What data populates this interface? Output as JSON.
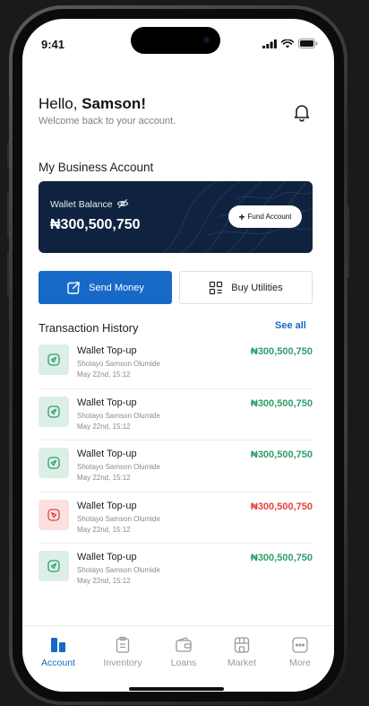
{
  "status_bar": {
    "time": "9:41"
  },
  "header": {
    "greeting_prefix": "Hello, ",
    "user_name": "Samson!",
    "subtitle": "Welcome back to your account."
  },
  "business_account": {
    "section_title": "My Business Account",
    "wallet_label": "Wallet Balance",
    "balance": "₦300,500,750",
    "fund_button_label": "Fund Account",
    "card_color": "#0f2340"
  },
  "actions": {
    "send_money_label": "Send Money",
    "buy_utilities_label": "Buy Utilities",
    "accent_color": "#1769c7"
  },
  "transactions": {
    "title": "Transaction History",
    "see_all_label": "See all",
    "items": [
      {
        "name": "Wallet Top-up",
        "person": "Shotayo Samson Olumide",
        "date": "May 22nd, 15:12",
        "amount": "₦300,500,750",
        "direction": "in"
      },
      {
        "name": "Wallet Top-up",
        "person": "Shotayo Samson Olumide",
        "date": "May 22nd, 15:12",
        "amount": "₦300,500,750",
        "direction": "in"
      },
      {
        "name": "Wallet Top-up",
        "person": "Shotayo Samson Olumide",
        "date": "May 22nd, 15:12",
        "amount": "₦300,500,750",
        "direction": "in"
      },
      {
        "name": "Wallet Top-up",
        "person": "Shotayo Samson Olumide",
        "date": "May 22nd, 15:12",
        "amount": "₦300,500,750",
        "direction": "out"
      },
      {
        "name": "Wallet Top-up",
        "person": "Shotayo Samson Olumide",
        "date": "May 22nd, 15:12",
        "amount": "₦300,500,750",
        "direction": "in"
      }
    ],
    "positive_color": "#2e9e6b",
    "negative_color": "#e0453e"
  },
  "bottom_nav": {
    "items": [
      {
        "label": "Account",
        "icon": "account-icon",
        "active": true
      },
      {
        "label": "Inventory",
        "icon": "inventory-icon",
        "active": false
      },
      {
        "label": "Loans",
        "icon": "wallet-icon",
        "active": false
      },
      {
        "label": "Market",
        "icon": "market-icon",
        "active": false
      },
      {
        "label": "More",
        "icon": "more-icon",
        "active": false
      }
    ]
  }
}
